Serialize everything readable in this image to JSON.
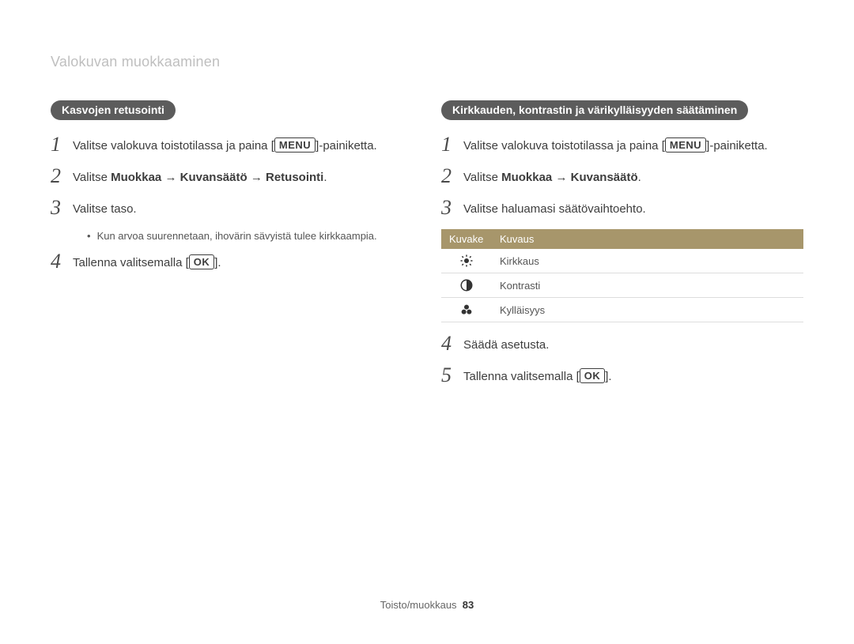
{
  "header": {
    "title": "Valokuvan muokkaaminen"
  },
  "labels": {
    "menu": "MENU",
    "ok": "OK",
    "arrow": "→",
    "lbracket": "[",
    "rbracket": "]"
  },
  "left": {
    "pill": "Kasvojen retusointi",
    "steps": [
      {
        "num": "1",
        "pre": "Valitse valokuva toistotilassa ja paina [",
        "mid": "MENU",
        "post": "]-painiketta."
      },
      {
        "num": "2",
        "parts": [
          "Valitse ",
          "Muokkaa",
          " → ",
          "Kuvansäätö",
          " → ",
          "Retusointi",
          "."
        ]
      },
      {
        "num": "3",
        "text": "Valitse taso.",
        "sub": "Kun arvoa suurennetaan, ihovärin sävyistä tulee kirkkaampia."
      },
      {
        "num": "4",
        "pre": "Tallenna valitsemalla [",
        "mid": "OK",
        "post": "]."
      }
    ]
  },
  "right": {
    "pill": "Kirkkauden, kontrastin ja värikylläisyyden säätäminen",
    "steps": [
      {
        "num": "1",
        "pre": "Valitse valokuva toistotilassa ja paina [",
        "mid": "MENU",
        "post": "]-painiketta."
      },
      {
        "num": "2",
        "parts": [
          "Valitse ",
          "Muokkaa",
          " → ",
          "Kuvansäätö",
          "."
        ]
      },
      {
        "num": "3",
        "text": "Valitse haluamasi säätövaihtoehto."
      },
      {
        "num": "4",
        "text": "Säädä asetusta."
      },
      {
        "num": "5",
        "pre": "Tallenna valitsemalla [",
        "mid": "OK",
        "post": "]."
      }
    ],
    "table": {
      "headers": [
        "Kuvake",
        "Kuvaus"
      ],
      "rows": [
        {
          "icon": "brightness",
          "label": "Kirkkaus"
        },
        {
          "icon": "contrast",
          "label": "Kontrasti"
        },
        {
          "icon": "saturation",
          "label": "Kylläisyys"
        }
      ]
    }
  },
  "footer": {
    "section": "Toisto/muokkaus",
    "page": "83"
  }
}
